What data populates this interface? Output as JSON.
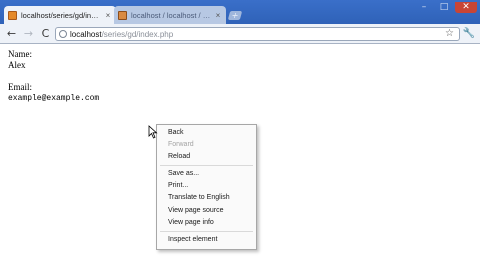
{
  "browser": {
    "tabs": [
      {
        "title": "localhost/series/gd/index...",
        "close": "×"
      },
      {
        "title": "localhost / localhost / a...",
        "close": "×"
      }
    ],
    "new_tab": "+",
    "window_controls": {
      "minimize": "–",
      "maximize": "□",
      "close": "✕"
    },
    "toolbar": {
      "back": "←",
      "forward": "→",
      "reload": "C",
      "url_host": "localhost",
      "url_path": "/series/gd/index.php",
      "bookmark_star": "☆",
      "menu": "🔧"
    }
  },
  "page": {
    "name_label": "Name:",
    "name_value": "Alex",
    "email_label": "Email:",
    "email_value": "example@example.com"
  },
  "context_menu": {
    "items": [
      {
        "label": "Back",
        "enabled": true
      },
      {
        "label": "Forward",
        "enabled": false
      },
      {
        "label": "Reload",
        "enabled": true
      },
      {
        "label": "Save as...",
        "enabled": true
      },
      {
        "label": "Print...",
        "enabled": true
      },
      {
        "label": "Translate to English",
        "enabled": true
      },
      {
        "label": "View page source",
        "enabled": true
      },
      {
        "label": "View page info",
        "enabled": true
      },
      {
        "label": "Inspect element",
        "enabled": true
      }
    ]
  },
  "colors": {
    "tabstrip": "#3a6fc9",
    "toolbar": "#eef2f8",
    "menu_background": "#fafafa",
    "disabled_text": "#a3a3a3"
  }
}
